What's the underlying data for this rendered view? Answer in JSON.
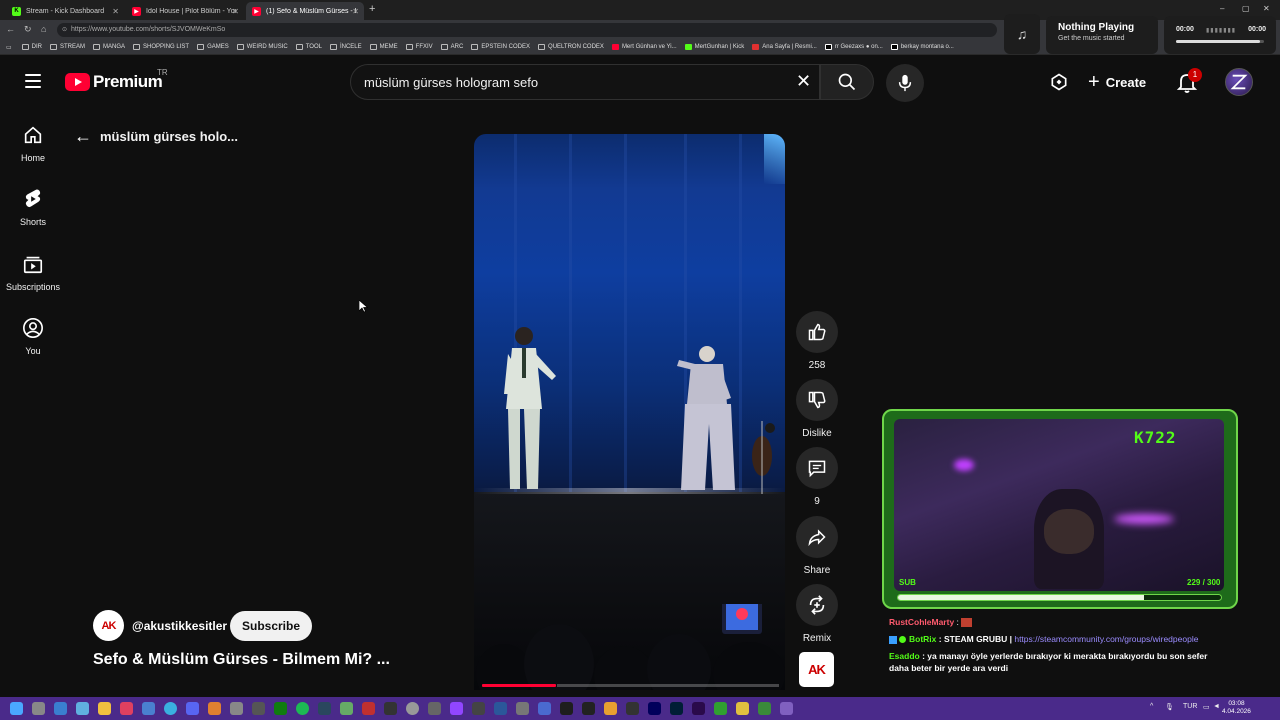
{
  "browser": {
    "tabs": [
      {
        "label": "Stream - Kick Dashboard",
        "favicon": "kick",
        "color": "#53fc18"
      },
      {
        "label": "Idol House | Pilot Bölüm - YouTube",
        "favicon": "youtube",
        "color": "#ff0033"
      },
      {
        "label": "(1) Sefo & Müslüm Gürses - B",
        "favicon": "youtube",
        "color": "#ff0033"
      }
    ],
    "url": "https://www.youtube.com/shorts/SJVOMWeKmSo",
    "bookmarks": [
      "DIR",
      "STREAM",
      "MANGA",
      "SHOPPING LIST",
      "GAMES",
      "WEIRD MUSIC",
      "TOOL",
      "İNCELE",
      "MEME",
      "FFXIV",
      "ARC",
      "EPSTEIN CODEX",
      "QUELTRON CODEX",
      "Mert Günhan ve Yi...",
      "MertGunhan | Kick",
      "Ana Sayfa | Resmi...",
      "rr Geezaxs ● on...",
      "berkay montana o..."
    ]
  },
  "now_playing": {
    "title": "Nothing Playing",
    "subtitle": "Get the music started",
    "time_start": "00:00",
    "time_end": "00:00",
    "progress": 0.95
  },
  "header": {
    "logo_text": "Premium",
    "country": "TR",
    "search_value": "müslüm gürses hologram sefo",
    "create_label": "Create",
    "notification_count": "1"
  },
  "sidebar": {
    "items": [
      {
        "label": "Home",
        "icon": "home-icon"
      },
      {
        "label": "Shorts",
        "icon": "shorts-icon"
      },
      {
        "label": "Subscriptions",
        "icon": "subscriptions-icon"
      },
      {
        "label": "You",
        "icon": "you-icon"
      }
    ]
  },
  "main": {
    "back_title": "müslüm gürses holo...",
    "channel_handle": "@akustikkesitler",
    "channel_initials": "AK",
    "subscribe_label": "Subscribe",
    "video_title": "Sefo & Müslüm Gürses - Bilmem Mi? ...",
    "video_progress": 0.25
  },
  "actions": {
    "like_count": "258",
    "dislike_label": "Dislike",
    "comment_count": "9",
    "share_label": "Share",
    "remix_label": "Remix"
  },
  "stream_overlay": {
    "kick_label": "K722",
    "sub_label": "SUB",
    "sub_count": "229 / 300",
    "sub_progress": 0.763,
    "chat": [
      {
        "user": "RustCohleMarty",
        "sep": " : ",
        "text": ""
      },
      {
        "user": "BotRix",
        "sep": " : ",
        "text": "STEAM GRUBU | ",
        "link": "https://steamcommunity.com/groups/wiredpeople"
      },
      {
        "user": "Esaddo",
        "sep": " : ",
        "text": "ya manayı öyle yerlerde bırakıyor ki merakta bırakıyordu bu son sefer daha beter bir yerde ara verdi"
      }
    ]
  },
  "taskbar": {
    "lang": "TUR",
    "time": "03:08",
    "date": "4.04.2026"
  },
  "colors": {
    "youtube_red": "#ff0033",
    "kick_green": "#53fc18",
    "taskbar": "#4a2a8a"
  }
}
